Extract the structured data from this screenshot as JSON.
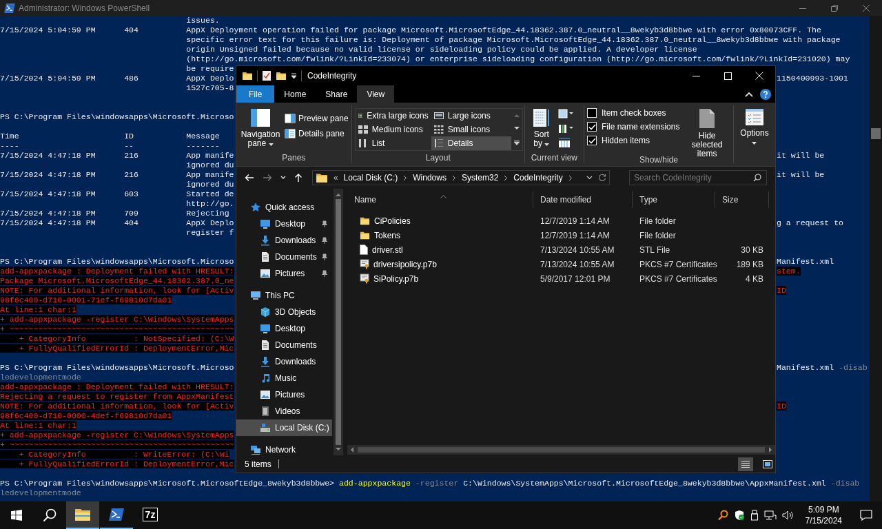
{
  "console": {
    "title": "Administrator: Windows PowerShell",
    "lines": [
      {
        "kind": "text",
        "left": [
          {
            "text": "                                       issues.",
            "kind": "output"
          }
        ]
      },
      {
        "kind": "text",
        "left": [
          {
            "text": "7/15/2024 5:04:59 PM      404          AppX Deployment operation failed for package Microsoft.MicrosoftEdge_44.18362.387.0_neutral__8wekyb3d8bbwe with error 0x80073CFF. The",
            "kind": "output"
          }
        ]
      },
      {
        "kind": "text",
        "left": [
          {
            "text": "                                       specific error text for this failure is: Deployment of package Microsoft.MicrosoftEdge_44.18362.387.0_neutral__8wekyb3d8bbwe with package",
            "kind": "output"
          }
        ]
      },
      {
        "kind": "text",
        "left": [
          {
            "text": "                                       origin Unsigned failed because no valid license or sideloading policy could be applied. A developer license",
            "kind": "output"
          }
        ]
      },
      {
        "kind": "text",
        "left": [
          {
            "text": "                                       (http://go.microsoft.com/fwlink/?LinkId=233074) or enterprise sideloading configuration (http://go.microsoft.com/fwlink/?LinkId=231020) may",
            "kind": "output"
          }
        ]
      },
      {
        "kind": "text",
        "left": [
          {
            "text": "                                       be require",
            "kind": "output"
          }
        ]
      },
      {
        "kind": "text",
        "left": [
          {
            "text": "7/15/2024 5:04:59 PM      486          AppX Deplo",
            "kind": "output"
          }
        ],
        "right": [
          {
            "text": "1150400993-1001",
            "kind": "output"
          }
        ]
      },
      {
        "kind": "text",
        "left": [
          {
            "text": "                                       1527c705-8",
            "kind": "output"
          }
        ]
      },
      {
        "kind": "blank"
      },
      {
        "kind": "blank"
      },
      {
        "kind": "text",
        "left": [
          {
            "text": "PS C:\\Program Files\\windowsapps\\Microsoft.Microso",
            "kind": "output"
          }
        ]
      },
      {
        "kind": "blank"
      },
      {
        "kind": "text",
        "left": [
          {
            "text": "Time                      ID           Message",
            "kind": "output"
          }
        ]
      },
      {
        "kind": "text",
        "left": [
          {
            "text": "----                      --           -------",
            "kind": "output"
          }
        ]
      },
      {
        "kind": "text",
        "left": [
          {
            "text": "7/15/2024 4:47:18 PM      216          App manife",
            "kind": "output"
          }
        ],
        "right": [
          {
            "text": "it will be",
            "kind": "output"
          }
        ]
      },
      {
        "kind": "text",
        "left": [
          {
            "text": "                                       ignored du",
            "kind": "output"
          }
        ]
      },
      {
        "kind": "text",
        "left": [
          {
            "text": "7/15/2024 4:47:18 PM      216          App manife",
            "kind": "output"
          }
        ],
        "right": [
          {
            "text": "it will be",
            "kind": "output"
          }
        ]
      },
      {
        "kind": "text",
        "left": [
          {
            "text": "                                       ignored du",
            "kind": "output"
          }
        ]
      },
      {
        "kind": "text",
        "left": [
          {
            "text": "7/15/2024 4:47:18 PM      603          Started de",
            "kind": "output"
          }
        ]
      },
      {
        "kind": "text",
        "left": [
          {
            "text": "                                       http://go.",
            "kind": "output"
          }
        ]
      },
      {
        "kind": "text",
        "left": [
          {
            "text": "7/15/2024 4:47:18 PM      709          Rejecting",
            "kind": "output"
          }
        ]
      },
      {
        "kind": "text",
        "left": [
          {
            "text": "7/15/2024 4:47:18 PM      404          AppX Deplo",
            "kind": "output"
          }
        ],
        "right": [
          {
            "text": "g a request to",
            "kind": "output"
          }
        ]
      },
      {
        "kind": "text",
        "left": [
          {
            "text": "                                       register f",
            "kind": "output"
          }
        ]
      },
      {
        "kind": "blank"
      },
      {
        "kind": "blank"
      },
      {
        "kind": "text",
        "left": [
          {
            "text": "PS C:\\Program Files\\windowsapps\\Microsoft.Microso",
            "kind": "output"
          }
        ],
        "right": [
          {
            "text": "Manifest.xml",
            "kind": "output"
          }
        ]
      },
      {
        "kind": "text",
        "left": [
          {
            "text": "add-appxpackage : Deployment failed with HRESULT:",
            "kind": "error"
          }
        ],
        "right": [
          {
            "text": "stem.",
            "kind": "error"
          }
        ]
      },
      {
        "kind": "text",
        "left": [
          {
            "text": "Package Microsoft.MicrosoftEdge_44.18362.387.0_ne",
            "kind": "error"
          }
        ]
      },
      {
        "kind": "text",
        "left": [
          {
            "text": "NOTE: For additional information, look for [Activ",
            "kind": "error"
          }
        ],
        "right": [
          {
            "text": "ID",
            "kind": "error"
          }
        ]
      },
      {
        "kind": "text",
        "left": [
          {
            "text": "98f6c400-d710-0001-71ef-f69810d7da01",
            "kind": "error"
          }
        ]
      },
      {
        "kind": "text",
        "left": [
          {
            "text": "At line:1 char:1",
            "kind": "error"
          }
        ]
      },
      {
        "kind": "text",
        "left": [
          {
            "text": "+ add-appxpackage -register C:\\Windows\\SystemApps",
            "kind": "error"
          }
        ]
      },
      {
        "kind": "text",
        "left": [
          {
            "text": "+ ~~~~~~~~~~~~~~~~~~~~~~~~~~~~~~~~~~~~~~~~~~~~~~~",
            "kind": "error"
          }
        ]
      },
      {
        "kind": "text",
        "left": [
          {
            "text": "    + CategoryInfo          : NotSpecified: (C:\\W",
            "kind": "error"
          }
        ]
      },
      {
        "kind": "text",
        "left": [
          {
            "text": "    + FullyQualifiedErrorId : DeploymentError,Mic",
            "kind": "error"
          }
        ]
      },
      {
        "kind": "blank"
      },
      {
        "kind": "text",
        "left": [
          {
            "text": "PS C:\\Program Files\\windowsapps\\Microsoft.Microso",
            "kind": "output"
          }
        ],
        "right": [
          {
            "text": "Manifest.xml",
            "kind": "output"
          },
          {
            "text": " -disab",
            "kind": "param"
          }
        ]
      },
      {
        "kind": "text",
        "left": [
          {
            "text": "ledevelopmentmode",
            "kind": "param"
          }
        ]
      },
      {
        "kind": "text",
        "left": [
          {
            "text": "add-appxpackage : Deployment failed with HRESULT:",
            "kind": "error"
          }
        ]
      },
      {
        "kind": "text",
        "left": [
          {
            "text": "Rejecting a request to register from AppxManifest",
            "kind": "error"
          }
        ]
      },
      {
        "kind": "text",
        "left": [
          {
            "text": "NOTE: For additional information, look for [Activ",
            "kind": "error"
          }
        ],
        "right": [
          {
            "text": "ID",
            "kind": "error"
          }
        ]
      },
      {
        "kind": "text",
        "left": [
          {
            "text": "98f6c400-d710-0000-4def-f69810d7da01",
            "kind": "error"
          }
        ]
      },
      {
        "kind": "text",
        "left": [
          {
            "text": "At line:1 char:1",
            "kind": "error"
          }
        ]
      },
      {
        "kind": "text",
        "left": [
          {
            "text": "+ add-appxpackage -register C:\\Windows\\SystemApps",
            "kind": "error"
          }
        ]
      },
      {
        "kind": "text",
        "left": [
          {
            "text": "+ ~~~~~~~~~~~~~~~~~~~~~~~~~~~~~~~~~~~~~~~~~~~~~~~",
            "kind": "error"
          }
        ]
      },
      {
        "kind": "text",
        "left": [
          {
            "text": "    + CategoryInfo          : WriteError: (C:\\Wi",
            "kind": "error"
          }
        ]
      },
      {
        "kind": "text",
        "left": [
          {
            "text": "    + FullyQualifiedErrorId : DeploymentError,Mic",
            "kind": "error"
          }
        ]
      },
      {
        "kind": "blank"
      },
      {
        "kind": "text",
        "left": [
          {
            "text": "PS C:\\Program Files\\windowsapps\\Microsoft.MicrosoftEdge_8wekyb3d8bbwe> ",
            "kind": "output"
          },
          {
            "text": "add-appxpackage",
            "kind": "command"
          },
          {
            "text": " -register",
            "kind": "param"
          },
          {
            "text": " C:\\Windows\\SystemApps\\Microsoft.MicrosoftEdge_8wekyb3d8bbwe\\AppxManifest.xml",
            "kind": "output"
          },
          {
            "text": " -disab",
            "kind": "param"
          }
        ]
      },
      {
        "kind": "text",
        "left": [
          {
            "text": "ledevelopmentmode",
            "kind": "param"
          }
        ]
      }
    ]
  },
  "explorer": {
    "title": "CodeIntegrity",
    "tabs": [
      {
        "label": "File",
        "kind": "file",
        "selected": false
      },
      {
        "label": "Home",
        "kind": "tab",
        "selected": false
      },
      {
        "label": "Share",
        "kind": "tab",
        "selected": false
      },
      {
        "label": "View",
        "kind": "tab",
        "selected": true
      }
    ],
    "ribbon": {
      "panes": {
        "label": "Panes",
        "navigation_pane": "Navigation pane",
        "buttons": [
          {
            "label": "Preview pane",
            "kind": "preview"
          },
          {
            "label": "Details pane",
            "kind": "details"
          }
        ]
      },
      "layout": {
        "label": "Layout",
        "options": [
          {
            "label": "Extra large icons",
            "kind": "xl",
            "selected": false
          },
          {
            "label": "Large icons",
            "kind": "large",
            "selected": false
          },
          {
            "label": "Medium icons",
            "kind": "medium",
            "selected": false
          },
          {
            "label": "Small icons",
            "kind": "small",
            "selected": false
          },
          {
            "label": "List",
            "kind": "list",
            "selected": false
          },
          {
            "label": "Details",
            "kind": "details",
            "selected": true
          }
        ]
      },
      "current_view": {
        "label": "Current view",
        "sort": "Sort by"
      },
      "show_hide": {
        "label": "Show/hide",
        "checks": [
          {
            "label": "Item check boxes",
            "checked": false
          },
          {
            "label": "File name extensions",
            "checked": true
          },
          {
            "label": "Hidden items",
            "checked": true
          }
        ],
        "hide_selected": "Hide selected items"
      },
      "options": "Options"
    },
    "address": {
      "overflow": "«",
      "crumbs": [
        "Local Disk (C:)",
        "Windows",
        "System32",
        "CodeIntegrity"
      ],
      "search_placeholder": "Search CodeIntegrity"
    },
    "nav": [
      {
        "label": "Quick access",
        "kind": "star",
        "selected": false,
        "children": [
          {
            "label": "Desktop",
            "kind": "desktop",
            "selected": false,
            "pinned": true
          },
          {
            "label": "Downloads",
            "kind": "downloads",
            "selected": false,
            "pinned": true
          },
          {
            "label": "Documents",
            "kind": "documents",
            "selected": false,
            "pinned": true
          },
          {
            "label": "Pictures",
            "kind": "pictures",
            "selected": false,
            "pinned": true
          }
        ]
      },
      {
        "label": "This PC",
        "kind": "pc",
        "selected": false,
        "children": [
          {
            "label": "3D Objects",
            "kind": "objects",
            "selected": false
          },
          {
            "label": "Desktop",
            "kind": "desktop",
            "selected": false
          },
          {
            "label": "Documents",
            "kind": "documents",
            "selected": false
          },
          {
            "label": "Downloads",
            "kind": "downloads",
            "selected": false
          },
          {
            "label": "Music",
            "kind": "music",
            "selected": false
          },
          {
            "label": "Pictures",
            "kind": "pictures",
            "selected": false
          },
          {
            "label": "Videos",
            "kind": "videos",
            "selected": false
          },
          {
            "label": "Local Disk (C:)",
            "kind": "drive",
            "selected": true
          }
        ]
      },
      {
        "label": "Network",
        "kind": "network",
        "selected": false
      }
    ],
    "columns": [
      "Name",
      "Date modified",
      "Type",
      "Size"
    ],
    "files": [
      {
        "name": "CiPolicies",
        "kind": "folder",
        "date": "12/7/2019 1:14 AM",
        "type": "File folder"
      },
      {
        "name": "Tokens",
        "kind": "folder",
        "date": "12/7/2019 1:14 AM",
        "type": "File folder"
      },
      {
        "name": "driver.stl",
        "kind": "file",
        "date": "7/13/2024 10:55 AM",
        "type": "STL File",
        "size": "30 KB"
      },
      {
        "name": "driversipolicy.p7b",
        "kind": "cert",
        "date": "7/13/2024 10:55 AM",
        "type": "PKCS #7 Certificates",
        "size": "189 KB"
      },
      {
        "name": "SiPolicy.p7b",
        "kind": "cert",
        "date": "5/9/2017 12:01 PM",
        "type": "PKCS #7 Certificates",
        "size": "4 KB"
      }
    ],
    "status": {
      "count": "5 items",
      "views": [
        {
          "kind": "details",
          "selected": true
        },
        {
          "kind": "large",
          "selected": false
        }
      ]
    }
  },
  "taskbar": {
    "apps": [
      {
        "kind": "explorer",
        "active": true,
        "running": true
      },
      {
        "kind": "powershell",
        "active": false,
        "running": true
      },
      {
        "kind": "sevenzip",
        "label": "7z",
        "active": false,
        "running": false
      }
    ],
    "clock": {
      "time": "5:09 PM",
      "date": "7/15/2024"
    }
  }
}
